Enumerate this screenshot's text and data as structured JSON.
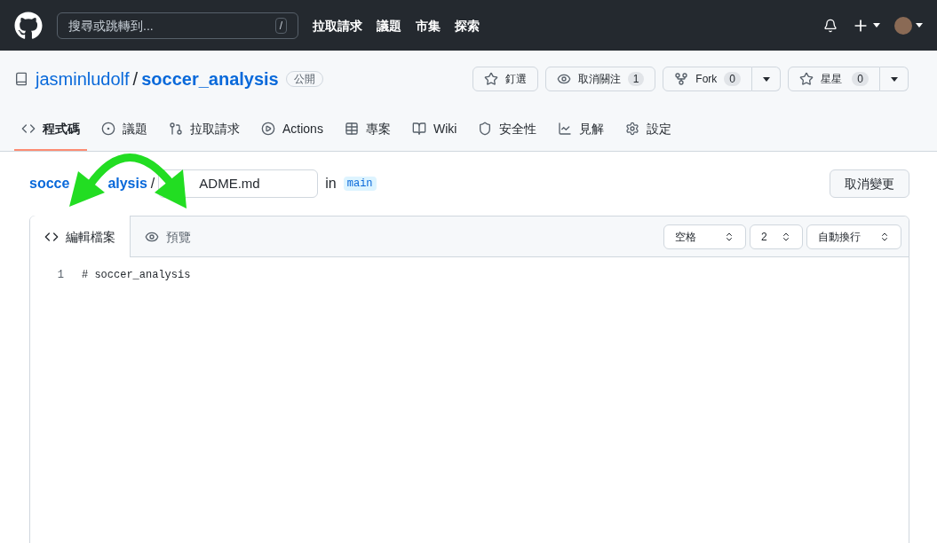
{
  "topbar": {
    "search_placeholder": "搜尋或跳轉到...",
    "search_key": "/",
    "nav": [
      "拉取請求",
      "議題",
      "市集",
      "探索"
    ]
  },
  "repo": {
    "owner": "jasminludolf",
    "separator": "/",
    "name": "soccer_analysis",
    "visibility": "公開",
    "actions": [
      {
        "kind": "pin",
        "label": "釘選",
        "dropdown": false
      },
      {
        "kind": "watch",
        "label": "取消關注",
        "count": "1",
        "dropdown": false
      },
      {
        "kind": "fork",
        "label": "Fork",
        "count": "0",
        "dropdown": true
      },
      {
        "kind": "star",
        "label": "星星",
        "count": "0",
        "dropdown": true
      }
    ]
  },
  "tabs": [
    {
      "kind": "code",
      "label": "程式碼",
      "selected": true
    },
    {
      "kind": "issues",
      "label": "議題",
      "selected": false
    },
    {
      "kind": "pulls",
      "label": "拉取請求",
      "selected": false
    },
    {
      "kind": "actions",
      "label": "Actions",
      "selected": false
    },
    {
      "kind": "projects",
      "label": "專案",
      "selected": false
    },
    {
      "kind": "wiki",
      "label": "Wiki",
      "selected": false
    },
    {
      "kind": "security",
      "label": "安全性",
      "selected": false
    },
    {
      "kind": "insights",
      "label": "見解",
      "selected": false
    },
    {
      "kind": "settings",
      "label": "設定",
      "selected": false
    }
  ],
  "breadcrumb": {
    "repo_start": "socce",
    "repo_end": "alysis",
    "separator": "/",
    "filename": "ADME.md",
    "in_label": "in",
    "branch": "main"
  },
  "cancel_button": "取消變更",
  "editor": {
    "tabs": [
      {
        "kind": "edit",
        "label": "編輯檔案",
        "selected": true
      },
      {
        "kind": "preview",
        "label": "預覽",
        "selected": false
      }
    ],
    "selects": [
      "空格",
      "2",
      "自動換行"
    ],
    "lines": [
      {
        "number": "1",
        "text": "# soccer_analysis"
      }
    ]
  }
}
